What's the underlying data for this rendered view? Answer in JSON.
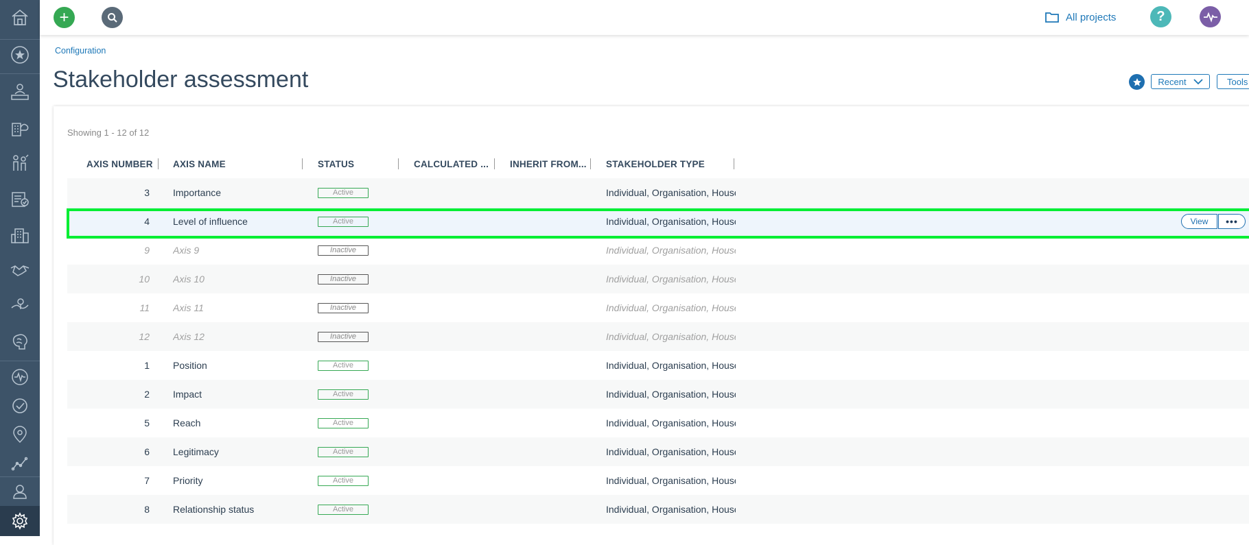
{
  "topbar": {
    "add_label": "+",
    "all_projects": "All projects",
    "help_label": "?"
  },
  "breadcrumb": "Configuration",
  "page_title": "Stakeholder assessment",
  "actions": {
    "recent": "Recent",
    "tools": "Tools"
  },
  "table": {
    "showing": "Showing 1 - 12 of 12",
    "columns": [
      "AXIS NUMBER",
      "AXIS NAME",
      "STATUS",
      "CALCULATED ...",
      "INHERIT FROM...",
      "STAKEHOLDER TYPE"
    ],
    "rows": [
      {
        "num": "3",
        "name": "Importance",
        "status": "Active",
        "type": "Individual, Organisation, House"
      },
      {
        "num": "4",
        "name": "Level of influence",
        "status": "Active",
        "type": "Individual, Organisation, House"
      },
      {
        "num": "9",
        "name": "Axis 9",
        "status": "Inactive",
        "type": "Individual, Organisation, House"
      },
      {
        "num": "10",
        "name": "Axis 10",
        "status": "Inactive",
        "type": "Individual, Organisation, House"
      },
      {
        "num": "11",
        "name": "Axis 11",
        "status": "Inactive",
        "type": "Individual, Organisation, House"
      },
      {
        "num": "12",
        "name": "Axis 12",
        "status": "Inactive",
        "type": "Individual, Organisation, House"
      },
      {
        "num": "1",
        "name": "Position",
        "status": "Active",
        "type": "Individual, Organisation, House"
      },
      {
        "num": "2",
        "name": "Impact",
        "status": "Active",
        "type": "Individual, Organisation, House"
      },
      {
        "num": "5",
        "name": "Reach",
        "status": "Active",
        "type": "Individual, Organisation, House"
      },
      {
        "num": "6",
        "name": "Legitimacy",
        "status": "Active",
        "type": "Individual, Organisation, House"
      },
      {
        "num": "7",
        "name": "Priority",
        "status": "Active",
        "type": "Individual, Organisation, House"
      },
      {
        "num": "8",
        "name": "Relationship status",
        "status": "Active",
        "type": "Individual, Organisation, House"
      }
    ],
    "row_actions": {
      "view": "View",
      "more": "•••"
    }
  },
  "colors": {
    "sidebar_bg": "#3d5368",
    "accent_blue": "#1e78b8",
    "add_green": "#35a853",
    "highlight_green": "#00ee33",
    "help_teal": "#4db8b8",
    "pulse_purple": "#7b5ea7"
  },
  "icons": {
    "sidebar": [
      "home-icon",
      "star-icon",
      "stakeholders-icon",
      "organisations-icon",
      "groups-icon",
      "tasks-icon",
      "buildings-icon",
      "handshake-icon",
      "map-pin-icon",
      "brain-icon",
      "activity-icon",
      "check-icon",
      "location-icon",
      "graph-icon",
      "user-icon",
      "settings-icon"
    ]
  }
}
